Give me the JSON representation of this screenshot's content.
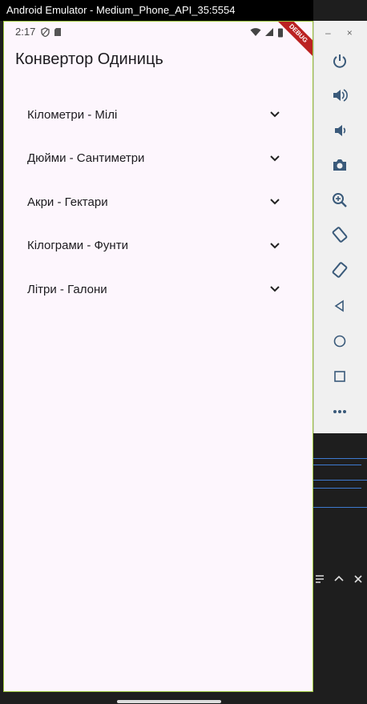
{
  "window": {
    "title": "Android Emulator - Medium_Phone_API_35:5554"
  },
  "statusbar": {
    "time": "2:17"
  },
  "debug_banner": "DEBUG",
  "app": {
    "title": "Конвертор Одиниць",
    "items": [
      {
        "label": "Кілометри - Мілі"
      },
      {
        "label": "Дюйми - Сантиметри"
      },
      {
        "label": "Акри - Гектари"
      },
      {
        "label": "Кілограми - Фунти"
      },
      {
        "label": "Літри - Галони"
      }
    ]
  },
  "emulator_controls": {
    "window_buttons": [
      "–",
      "×"
    ],
    "icons": [
      "power-icon",
      "volume-up-icon",
      "volume-down-icon",
      "camera-icon",
      "zoom-icon",
      "rotate-left-icon",
      "rotate-right-icon",
      "back-icon",
      "home-icon",
      "overview-icon",
      "more-icon"
    ]
  },
  "colors": {
    "app_background": "#fdf6fd",
    "accent_border": "#9bc43a",
    "text": "#1c1b1f",
    "control_icon": "#3a5a7a"
  }
}
